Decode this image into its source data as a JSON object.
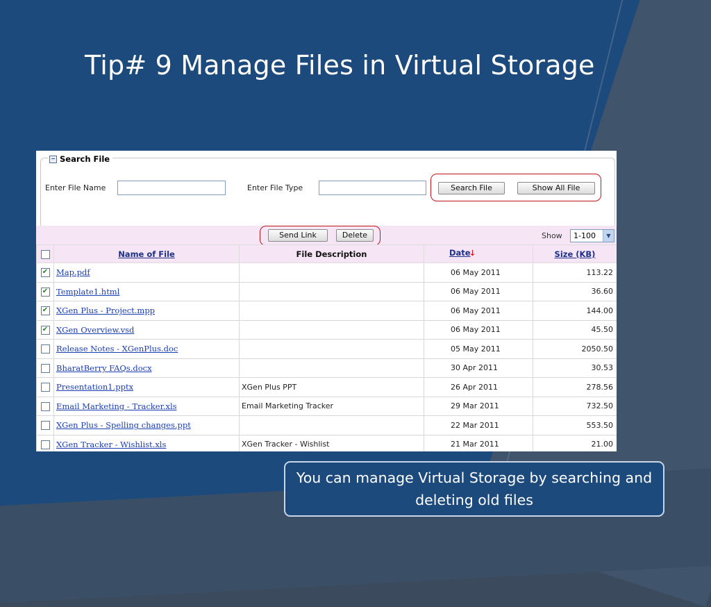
{
  "slide": {
    "title": "Tip# 9 Manage Files in Virtual Storage",
    "callout": "You can manage Virtual Storage by searching and deleting old files"
  },
  "search": {
    "legend": "Search File",
    "legend_icon": "minus-box-icon",
    "file_name_label": "Enter File Name",
    "file_name_value": "",
    "file_type_label": "Enter File Type",
    "file_type_value": "",
    "search_button": "Search File",
    "show_all_button": "Show All File"
  },
  "toolbar": {
    "send_link_button": "Send Link",
    "delete_button": "Delete",
    "show_label": "Show",
    "show_value": "1-100"
  },
  "table": {
    "columns": {
      "name": "Name of File",
      "description": "File Description",
      "date": "Date",
      "size": "Size (KB)"
    },
    "rows": [
      {
        "checked": true,
        "name": "Map.pdf",
        "description": "",
        "date": "06 May 2011",
        "size": "113.22"
      },
      {
        "checked": true,
        "name": "Template1.html",
        "description": "",
        "date": "06 May 2011",
        "size": "36.60"
      },
      {
        "checked": true,
        "name": "XGen Plus - Project.mpp",
        "description": "",
        "date": "06 May 2011",
        "size": "144.00"
      },
      {
        "checked": true,
        "name": "XGen Overview.vsd",
        "description": "",
        "date": "06 May 2011",
        "size": "45.50"
      },
      {
        "checked": false,
        "name": "Release Notes - XGenPlus.doc",
        "description": "",
        "date": "05 May 2011",
        "size": "2050.50"
      },
      {
        "checked": false,
        "name": "BharatBerry FAQs.docx",
        "description": "",
        "date": "30 Apr 2011",
        "size": "30.53"
      },
      {
        "checked": false,
        "name": "Presentation1.pptx",
        "description": "XGen Plus PPT",
        "date": "26 Apr 2011",
        "size": "278.56"
      },
      {
        "checked": false,
        "name": "Email Marketing - Tracker.xls",
        "description": "Email Marketing Tracker",
        "date": "29 Mar 2011",
        "size": "732.50"
      },
      {
        "checked": false,
        "name": "XGen Plus - Spelling changes.ppt",
        "description": "",
        "date": "22 Mar 2011",
        "size": "553.50"
      },
      {
        "checked": false,
        "name": "XGen Tracker - Wishlist.xls",
        "description": "XGen Tracker - Wishlist",
        "date": "21 Mar 2011",
        "size": "21.00"
      }
    ]
  },
  "colors": {
    "slide_background": "#1d4a7c",
    "header_row": "#f6e6f5",
    "highlight_oval": "#c0121b",
    "link": "#1a3db3"
  }
}
